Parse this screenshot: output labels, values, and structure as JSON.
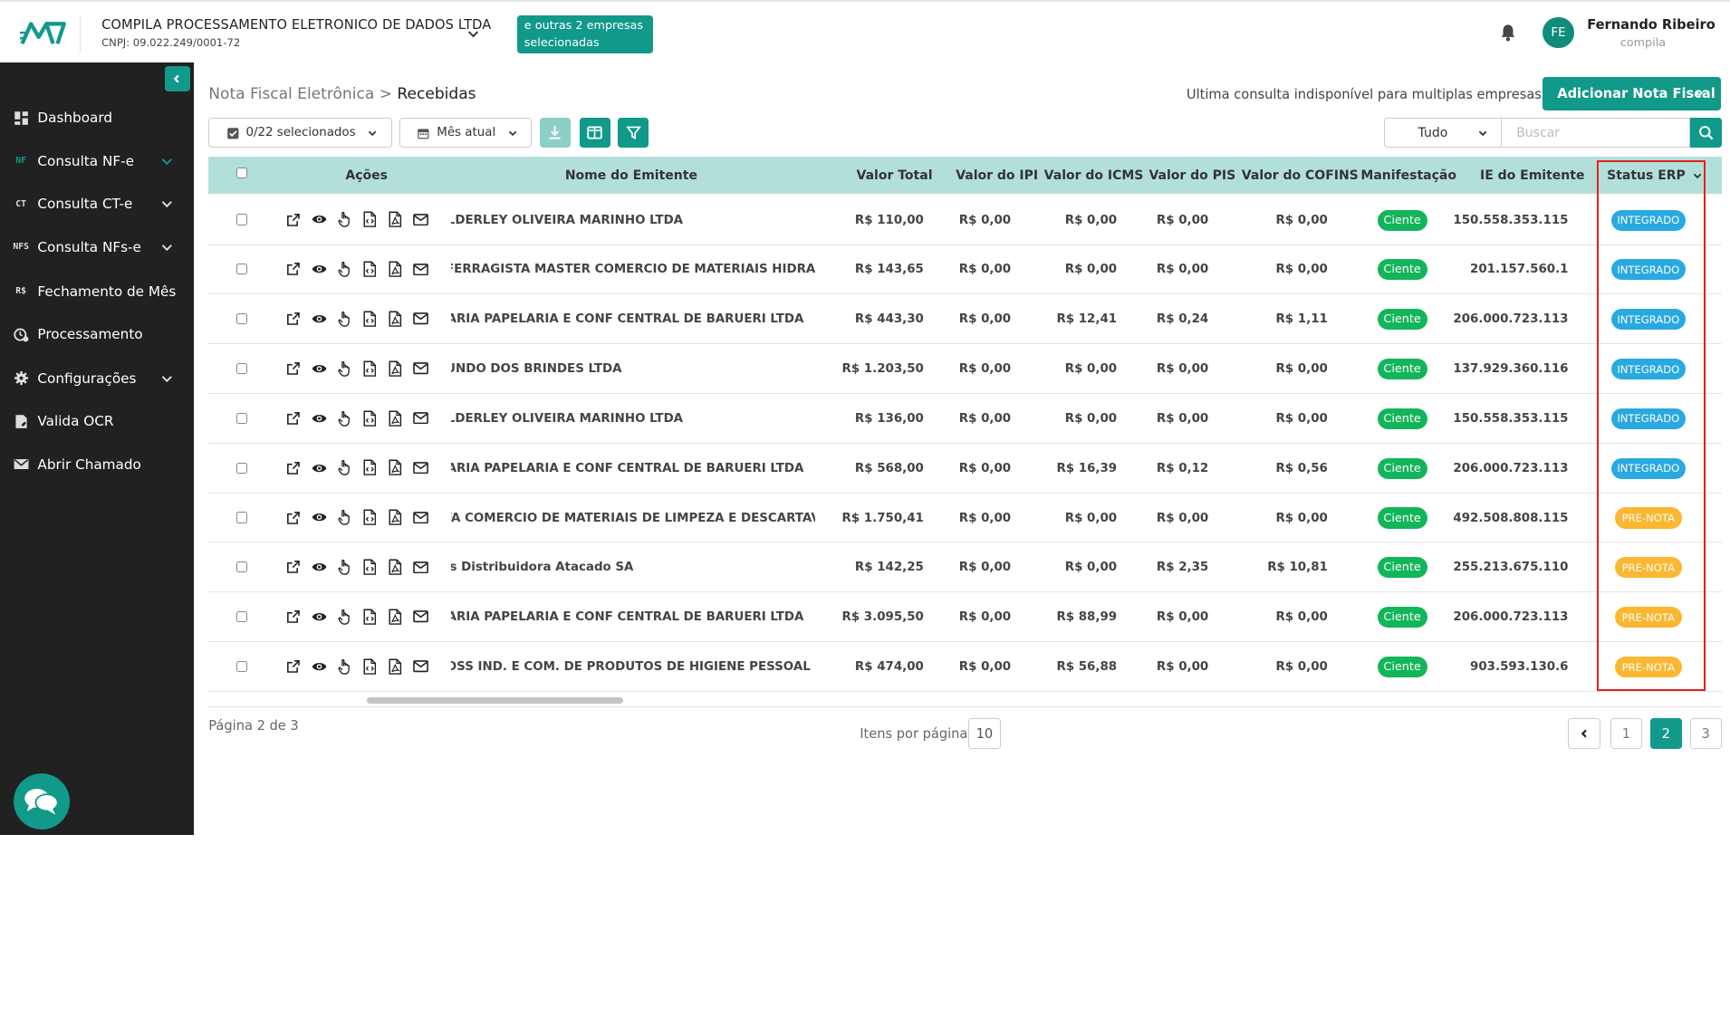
{
  "header": {
    "company_name": "COMPILA PROCESSAMENTO ELETRONICO DE DADOS LTDA",
    "company_cnpj": "CNPJ: 09.022.249/0001-72",
    "others_badge_line1": "e outras 2 empresas",
    "others_badge_line2": "selecionadas",
    "avatar_initials": "FE",
    "user_name": "Fernando Ribeiro",
    "user_org": "compila"
  },
  "sidebar": {
    "items": [
      {
        "label": "Dashboard",
        "icon": "grid-icon",
        "expandable": false
      },
      {
        "label": "Consulta NF-e",
        "icon": "nf-icon",
        "icon_text": "NF",
        "expandable": true,
        "active": true
      },
      {
        "label": "Consulta CT-e",
        "icon": "ct-icon",
        "icon_text": "CT",
        "expandable": true
      },
      {
        "label": "Consulta NFs-e",
        "icon": "nfs-icon",
        "icon_text": "NFS",
        "expandable": true
      },
      {
        "label": "Fechamento de Mês",
        "icon": "currency-icon",
        "icon_text": "R$",
        "expandable": false
      },
      {
        "label": "Processamento",
        "icon": "processing-icon",
        "expandable": false
      },
      {
        "label": "Configurações",
        "icon": "gear-icon",
        "expandable": true
      },
      {
        "label": "Valida OCR",
        "icon": "ocr-doc-icon",
        "expandable": false
      },
      {
        "label": "Abrir Chamado",
        "icon": "mail-icon",
        "expandable": false
      }
    ]
  },
  "page": {
    "breadcrumb_parent": "Nota Fiscal Eletrônica",
    "breadcrumb_sep": ">",
    "breadcrumb_current": "Recebidas",
    "last_query_text": "Ultima consulta indisponível para multiplas empresas",
    "add_button_label": "Adicionar Nota Fiscal"
  },
  "toolbar": {
    "selection_label": "0/22 selecionados",
    "period_label": "Mês atual",
    "filter_select_value": "Tudo",
    "search_placeholder": "Buscar"
  },
  "table": {
    "columns": [
      "Ações",
      "Nome do Emitente",
      "Valor Total",
      "Valor do IPI",
      "Valor do ICMS",
      "Valor do PIS",
      "Valor do COFINS",
      "Manifestação",
      "IE do Emitente",
      "Status ERP"
    ],
    "rows": [
      {
        "emitente": "VALDERLEY OLIVEIRA MARINHO LTDA",
        "total": "R$ 110,00",
        "ipi": "R$ 0,00",
        "icms": "R$ 0,00",
        "pis": "R$ 0,00",
        "cofins": "R$ 0,00",
        "manifestacao": "Ciente",
        "ie": "150.558.353.115",
        "status": "INTEGRADO"
      },
      {
        "emitente": "CASA FERRAGISTA MASTER COMERCIO DE MATERIAIS HIDRAULICOS LTDA",
        "total": "R$ 143,65",
        "ipi": "R$ 0,00",
        "icms": "R$ 0,00",
        "pis": "R$ 0,00",
        "cofins": "R$ 0,00",
        "manifestacao": "Ciente",
        "ie": "201.157.560.1",
        "status": "INTEGRADO"
      },
      {
        "emitente": "PAPELARIA PAPELARIA E CONF CENTRAL DE BARUERI LTDA",
        "total": "R$ 443,30",
        "ipi": "R$ 0,00",
        "icms": "R$ 12,41",
        "pis": "R$ 0,24",
        "cofins": "R$ 1,11",
        "manifestacao": "Ciente",
        "ie": "206.000.723.113",
        "status": "INTEGRADO"
      },
      {
        "emitente": "MUNDO DOS BRINDES LTDA",
        "total": "R$ 1.203,50",
        "ipi": "R$ 0,00",
        "icms": "R$ 0,00",
        "pis": "R$ 0,00",
        "cofins": "R$ 0,00",
        "manifestacao": "Ciente",
        "ie": "137.929.360.116",
        "status": "INTEGRADO"
      },
      {
        "emitente": "VALDERLEY OLIVEIRA MARINHO LTDA",
        "total": "R$ 136,00",
        "ipi": "R$ 0,00",
        "icms": "R$ 0,00",
        "pis": "R$ 0,00",
        "cofins": "R$ 0,00",
        "manifestacao": "Ciente",
        "ie": "150.558.353.115",
        "status": "INTEGRADO"
      },
      {
        "emitente": "PAPELARIA PAPELARIA E CONF CENTRAL DE BARUERI LTDA",
        "total": "R$ 568,00",
        "ipi": "R$ 0,00",
        "icms": "R$ 16,39",
        "pis": "R$ 0,12",
        "cofins": "R$ 0,56",
        "manifestacao": "Ciente",
        "ie": "206.000.723.113",
        "status": "INTEGRADO"
      },
      {
        "emitente": "ALFA COMERCIO DE MATERIAIS DE LIMPEZA E DESCARTAVEIS LTDA",
        "total": "R$ 1.750,41",
        "ipi": "R$ 0,00",
        "icms": "R$ 0,00",
        "pis": "R$ 0,00",
        "cofins": "R$ 0,00",
        "manifestacao": "Ciente",
        "ie": "492.508.808.115",
        "status": "PRE-NOTA"
      },
      {
        "emitente": "Sendas Distribuidora Atacado SA",
        "total": "R$ 142,25",
        "ipi": "R$ 0,00",
        "icms": "R$ 0,00",
        "pis": "R$ 2,35",
        "cofins": "R$ 10,81",
        "manifestacao": "Ciente",
        "ie": "255.213.675.110",
        "status": "PRE-NOTA"
      },
      {
        "emitente": "PAPELARIA PAPELARIA E CONF CENTRAL DE BARUERI LTDA",
        "total": "R$ 3.095,50",
        "ipi": "R$ 0,00",
        "icms": "R$ 88,99",
        "pis": "R$ 0,00",
        "cofins": "R$ 0,00",
        "manifestacao": "Ciente",
        "ie": "206.000.723.113",
        "status": "PRE-NOTA"
      },
      {
        "emitente": "BIOGLOSS IND. E COM. DE PRODUTOS DE HIGIENE PESSOAL LTDA",
        "total": "R$ 474,00",
        "ipi": "R$ 0,00",
        "icms": "R$ 56,88",
        "pis": "R$ 0,00",
        "cofins": "R$ 0,00",
        "manifestacao": "Ciente",
        "ie": "903.593.130.6",
        "status": "PRE-NOTA"
      }
    ]
  },
  "pagination": {
    "page_info": "Página 2 de 3",
    "per_page_label": "Itens por página",
    "per_page_value": "10",
    "pages": [
      "1",
      "2",
      "3"
    ],
    "current_page": "2"
  },
  "colors": {
    "brand": "#11998a",
    "header_row": "#b3dfdb",
    "sidebar_bg": "#212121",
    "ciente": "#13b55a",
    "integrado": "#29a9e1",
    "pre_nota": "#fbb731",
    "highlight_border": "#e0211b"
  }
}
